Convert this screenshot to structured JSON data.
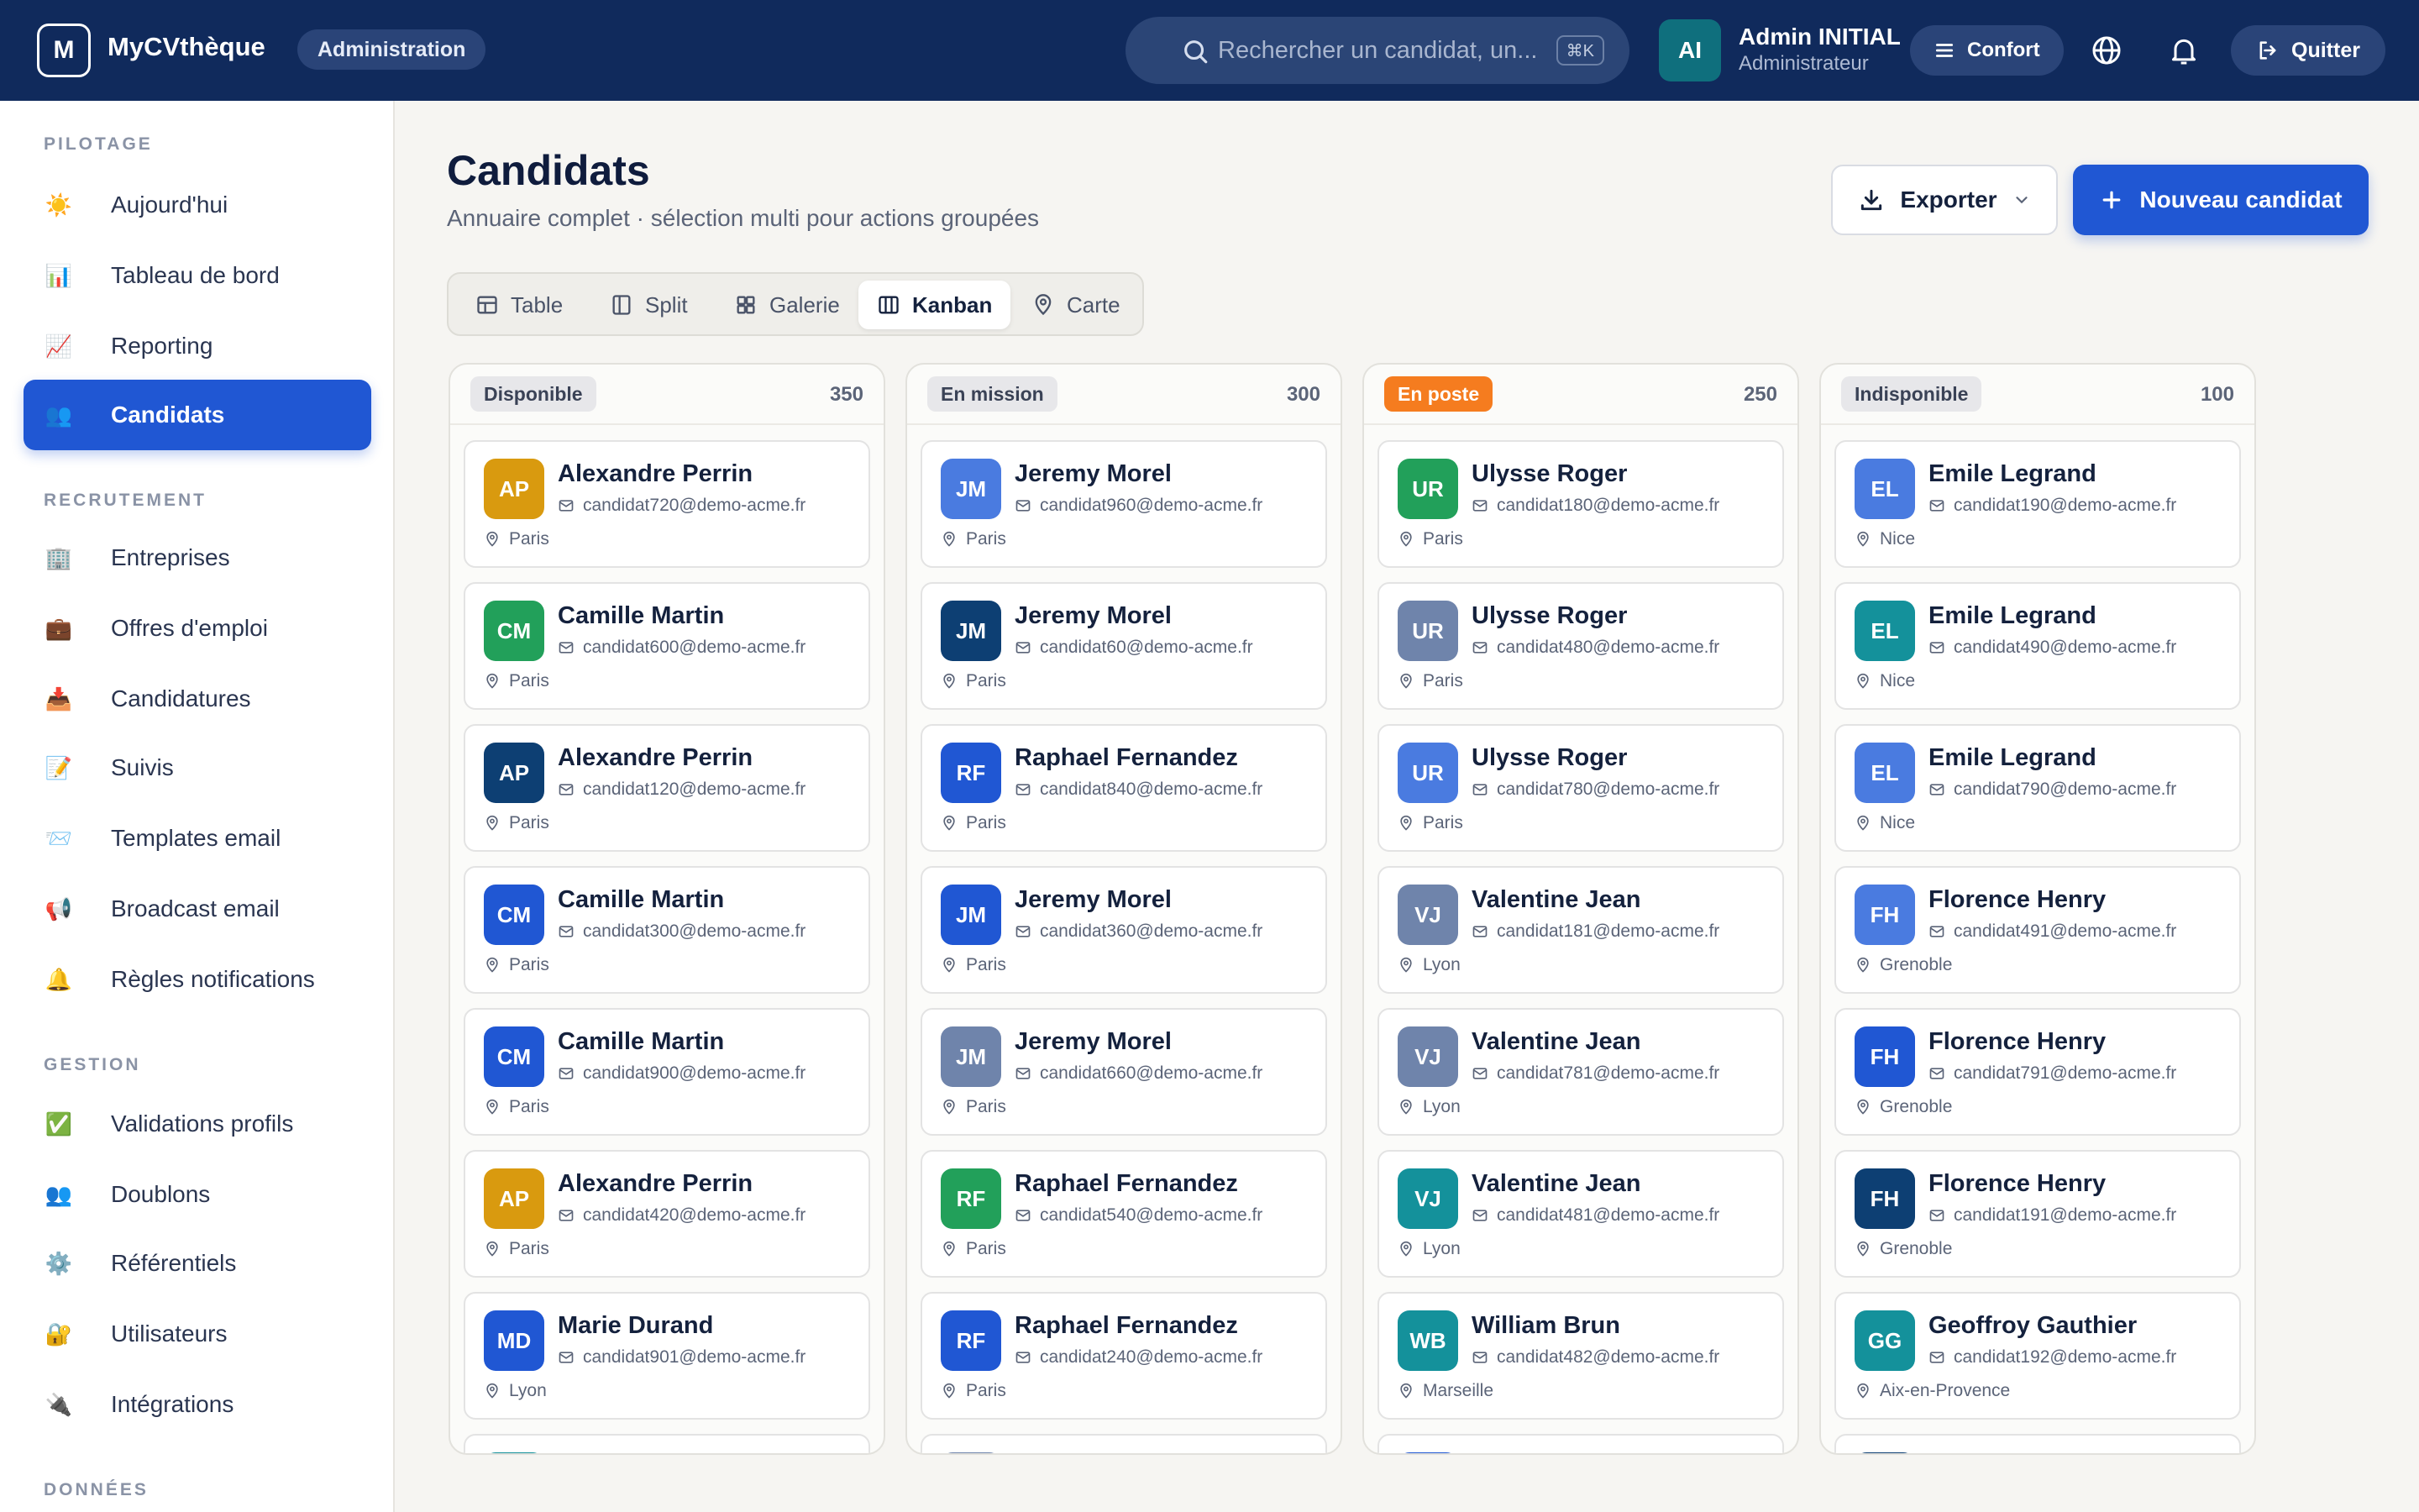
{
  "topbar": {
    "brand_letter": "M",
    "brand_name": "MyCVthèque",
    "area": "Administration",
    "search_placeholder": "Rechercher un candidat, un...",
    "search_shortcut": "⌘K",
    "user_initials": "AI",
    "user_name": "Admin INITIAL",
    "user_role": "Administrateur",
    "density_label": "Confort",
    "quit_label": "Quitter",
    "colors": {
      "bar": "#102a5c",
      "pill": "#2a4478",
      "avatar": "#0f6f7d"
    }
  },
  "sidebar": {
    "sections": [
      {
        "title": "PILOTAGE",
        "items": [
          {
            "icon": "☀️",
            "label": "Aujourd'hui"
          },
          {
            "icon": "📊",
            "label": "Tableau de bord"
          },
          {
            "icon": "📈",
            "label": "Reporting"
          },
          {
            "icon": "👥",
            "label": "Candidats",
            "active": true
          }
        ]
      },
      {
        "title": "RECRUTEMENT",
        "items": [
          {
            "icon": "🏢",
            "label": "Entreprises"
          },
          {
            "icon": "💼",
            "label": "Offres d'emploi"
          },
          {
            "icon": "📥",
            "label": "Candidatures"
          },
          {
            "icon": "📝",
            "label": "Suivis"
          },
          {
            "icon": "📨",
            "label": "Templates email"
          },
          {
            "icon": "📢",
            "label": "Broadcast email"
          },
          {
            "icon": "🔔",
            "label": "Règles notifications"
          }
        ]
      },
      {
        "title": "GESTION",
        "items": [
          {
            "icon": "✅",
            "label": "Validations profils"
          },
          {
            "icon": "👥",
            "label": "Doublons"
          },
          {
            "icon": "⚙️",
            "label": "Référentiels"
          },
          {
            "icon": "🔐",
            "label": "Utilisateurs"
          },
          {
            "icon": "🔌",
            "label": "Intégrations"
          }
        ]
      },
      {
        "title": "DONNÉES",
        "items": []
      }
    ],
    "active_color": "#2057d3"
  },
  "main": {
    "title": "Candidats",
    "subtitle": "Annuaire complet · sélection multi pour actions groupées",
    "export_label": "Exporter",
    "new_label": "Nouveau candidat",
    "views": [
      {
        "label": "Table",
        "icon": "table-icon"
      },
      {
        "label": "Split",
        "icon": "split-icon"
      },
      {
        "label": "Galerie",
        "icon": "grid-icon"
      },
      {
        "label": "Kanban",
        "icon": "kanban-icon",
        "active": true
      },
      {
        "label": "Carte",
        "icon": "map-pin-icon"
      }
    ]
  },
  "kanban": {
    "columns": [
      {
        "status": "Disponible",
        "count": "350",
        "badge_bg": "#e7e7ea",
        "badge_fg": "#3a4256",
        "cards": [
          {
            "initials": "AP",
            "name": "Alexandre Perrin",
            "email": "candidat720@demo-acme.fr",
            "city": "Paris",
            "color": "#d99a0f"
          },
          {
            "initials": "CM",
            "name": "Camille Martin",
            "email": "candidat600@demo-acme.fr",
            "city": "Paris",
            "color": "#22a05a"
          },
          {
            "initials": "AP",
            "name": "Alexandre Perrin",
            "email": "candidat120@demo-acme.fr",
            "city": "Paris",
            "color": "#0d3f73"
          },
          {
            "initials": "CM",
            "name": "Camille Martin",
            "email": "candidat300@demo-acme.fr",
            "city": "Paris",
            "color": "#2057d3"
          },
          {
            "initials": "CM",
            "name": "Camille Martin",
            "email": "candidat900@demo-acme.fr",
            "city": "Paris",
            "color": "#2057d3"
          },
          {
            "initials": "AP",
            "name": "Alexandre Perrin",
            "email": "candidat420@demo-acme.fr",
            "city": "Paris",
            "color": "#d99a0f"
          },
          {
            "initials": "MD",
            "name": "Marie Durand",
            "email": "candidat901@demo-acme.fr",
            "city": "Lyon",
            "color": "#2057d3"
          }
        ],
        "peek_color": "#14919b"
      },
      {
        "status": "En mission",
        "count": "300",
        "badge_bg": "#e7e7ea",
        "badge_fg": "#3a4256",
        "cards": [
          {
            "initials": "JM",
            "name": "Jeremy Morel",
            "email": "candidat960@demo-acme.fr",
            "city": "Paris",
            "color": "#4a7be0"
          },
          {
            "initials": "JM",
            "name": "Jeremy Morel",
            "email": "candidat60@demo-acme.fr",
            "city": "Paris",
            "color": "#0d3f73"
          },
          {
            "initials": "RF",
            "name": "Raphael Fernandez",
            "email": "candidat840@demo-acme.fr",
            "city": "Paris",
            "color": "#2057d3"
          },
          {
            "initials": "JM",
            "name": "Jeremy Morel",
            "email": "candidat360@demo-acme.fr",
            "city": "Paris",
            "color": "#2057d3"
          },
          {
            "initials": "JM",
            "name": "Jeremy Morel",
            "email": "candidat660@demo-acme.fr",
            "city": "Paris",
            "color": "#6f84ab"
          },
          {
            "initials": "RF",
            "name": "Raphael Fernandez",
            "email": "candidat540@demo-acme.fr",
            "city": "Paris",
            "color": "#22a05a"
          },
          {
            "initials": "RF",
            "name": "Raphael Fernandez",
            "email": "candidat240@demo-acme.fr",
            "city": "Paris",
            "color": "#2057d3"
          }
        ],
        "peek_color": "#6f84ab"
      },
      {
        "status": "En poste",
        "count": "250",
        "badge_bg": "#f57c1f",
        "badge_fg": "#ffffff",
        "cards": [
          {
            "initials": "UR",
            "name": "Ulysse Roger",
            "email": "candidat180@demo-acme.fr",
            "city": "Paris",
            "color": "#22a05a"
          },
          {
            "initials": "UR",
            "name": "Ulysse Roger",
            "email": "candidat480@demo-acme.fr",
            "city": "Paris",
            "color": "#6f84ab"
          },
          {
            "initials": "UR",
            "name": "Ulysse Roger",
            "email": "candidat780@demo-acme.fr",
            "city": "Paris",
            "color": "#4a7be0"
          },
          {
            "initials": "VJ",
            "name": "Valentine Jean",
            "email": "candidat181@demo-acme.fr",
            "city": "Lyon",
            "color": "#6f84ab"
          },
          {
            "initials": "VJ",
            "name": "Valentine Jean",
            "email": "candidat781@demo-acme.fr",
            "city": "Lyon",
            "color": "#6f84ab"
          },
          {
            "initials": "VJ",
            "name": "Valentine Jean",
            "email": "candidat481@demo-acme.fr",
            "city": "Lyon",
            "color": "#14919b"
          },
          {
            "initials": "WB",
            "name": "William Brun",
            "email": "candidat482@demo-acme.fr",
            "city": "Marseille",
            "color": "#14919b"
          }
        ],
        "peek_color": "#2057d3"
      },
      {
        "status": "Indisponible",
        "count": "100",
        "badge_bg": "#e7e7ea",
        "badge_fg": "#3a4256",
        "cards": [
          {
            "initials": "EL",
            "name": "Emile Legrand",
            "email": "candidat190@demo-acme.fr",
            "city": "Nice",
            "color": "#4a7be0"
          },
          {
            "initials": "EL",
            "name": "Emile Legrand",
            "email": "candidat490@demo-acme.fr",
            "city": "Nice",
            "color": "#14919b"
          },
          {
            "initials": "EL",
            "name": "Emile Legrand",
            "email": "candidat790@demo-acme.fr",
            "city": "Nice",
            "color": "#4a7be0"
          },
          {
            "initials": "FH",
            "name": "Florence Henry",
            "email": "candidat491@demo-acme.fr",
            "city": "Grenoble",
            "color": "#4a7be0"
          },
          {
            "initials": "FH",
            "name": "Florence Henry",
            "email": "candidat791@demo-acme.fr",
            "city": "Grenoble",
            "color": "#2057d3"
          },
          {
            "initials": "FH",
            "name": "Florence Henry",
            "email": "candidat191@demo-acme.fr",
            "city": "Grenoble",
            "color": "#0d3f73"
          },
          {
            "initials": "GG",
            "name": "Geoffroy Gauthier",
            "email": "candidat192@demo-acme.fr",
            "city": "Aix-en-Provence",
            "color": "#14919b"
          }
        ],
        "peek_color": "#0d3f73"
      }
    ]
  }
}
